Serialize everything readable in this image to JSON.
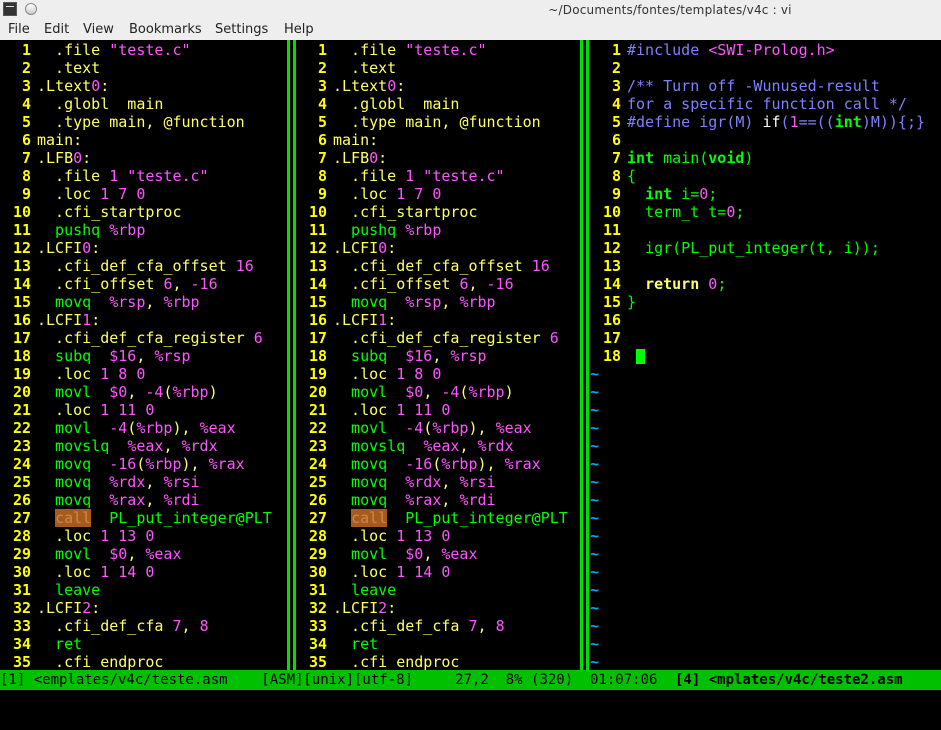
{
  "window": {
    "title": "~/Documents/fontes/templates/v4c : vi"
  },
  "menubar": {
    "items": [
      "File",
      "Edit",
      "View",
      "Bookmarks",
      "Settings",
      "Help"
    ]
  },
  "panes": [
    {
      "lines": [
        [
          {
            "t": "  .file ",
            "c": "dir"
          },
          {
            "t": "\"teste.c\"",
            "c": "str"
          }
        ],
        [
          {
            "t": "  .text",
            "c": "dir"
          }
        ],
        [
          {
            "t": ".Ltext",
            "c": "lab"
          },
          {
            "t": "0",
            "c": "num"
          },
          {
            "t": ":",
            "c": "lab"
          }
        ],
        [
          {
            "t": "  .globl  main",
            "c": "dir"
          }
        ],
        [
          {
            "t": "  .type main, ",
            "c": "dir"
          },
          {
            "t": "@function",
            "c": "dir"
          }
        ],
        [
          {
            "t": "main:",
            "c": "lab"
          }
        ],
        [
          {
            "t": ".LFB",
            "c": "lab"
          },
          {
            "t": "0",
            "c": "num"
          },
          {
            "t": ":",
            "c": "lab"
          }
        ],
        [
          {
            "t": "  .file ",
            "c": "dir"
          },
          {
            "t": "1",
            "c": "num"
          },
          {
            "t": " \"teste.c\"",
            "c": "str"
          }
        ],
        [
          {
            "t": "  .loc ",
            "c": "dir"
          },
          {
            "t": "1 7 0",
            "c": "num"
          }
        ],
        [
          {
            "t": "  .cfi_startproc",
            "c": "dir"
          }
        ],
        [
          {
            "t": "  pushq ",
            "c": "ins"
          },
          {
            "t": "%rbp",
            "c": "reg"
          }
        ],
        [
          {
            "t": ".LCFI",
            "c": "lab"
          },
          {
            "t": "0",
            "c": "num"
          },
          {
            "t": ":",
            "c": "lab"
          }
        ],
        [
          {
            "t": "  .cfi_def_cfa_offset ",
            "c": "dir"
          },
          {
            "t": "16",
            "c": "num"
          }
        ],
        [
          {
            "t": "  .cfi_offset ",
            "c": "dir"
          },
          {
            "t": "6",
            "c": "num"
          },
          {
            "t": ", ",
            "c": "p"
          },
          {
            "t": "-16",
            "c": "num"
          }
        ],
        [
          {
            "t": "  movq  ",
            "c": "ins"
          },
          {
            "t": "%rsp",
            "c": "reg"
          },
          {
            "t": ", ",
            "c": "p"
          },
          {
            "t": "%rbp",
            "c": "reg"
          }
        ],
        [
          {
            "t": ".LCFI",
            "c": "lab"
          },
          {
            "t": "1",
            "c": "num"
          },
          {
            "t": ":",
            "c": "lab"
          }
        ],
        [
          {
            "t": "  .cfi_def_cfa_register ",
            "c": "dir"
          },
          {
            "t": "6",
            "c": "num"
          }
        ],
        [
          {
            "t": "  subq  ",
            "c": "ins"
          },
          {
            "t": "$16",
            "c": "num"
          },
          {
            "t": ", ",
            "c": "p"
          },
          {
            "t": "%rsp",
            "c": "reg"
          }
        ],
        [
          {
            "t": "  .loc ",
            "c": "dir"
          },
          {
            "t": "1 8 0",
            "c": "num"
          }
        ],
        [
          {
            "t": "  movl  ",
            "c": "ins"
          },
          {
            "t": "$0",
            "c": "num"
          },
          {
            "t": ", ",
            "c": "p"
          },
          {
            "t": "-4",
            "c": "num"
          },
          {
            "t": "(",
            "c": "p"
          },
          {
            "t": "%rbp",
            "c": "reg"
          },
          {
            "t": ")",
            "c": "p"
          }
        ],
        [
          {
            "t": "  .loc ",
            "c": "dir"
          },
          {
            "t": "1 11 0",
            "c": "num"
          }
        ],
        [
          {
            "t": "  movl  ",
            "c": "ins"
          },
          {
            "t": "-4",
            "c": "num"
          },
          {
            "t": "(",
            "c": "p"
          },
          {
            "t": "%rbp",
            "c": "reg"
          },
          {
            "t": "), ",
            "c": "p"
          },
          {
            "t": "%eax",
            "c": "reg"
          }
        ],
        [
          {
            "t": "  movslq  ",
            "c": "ins"
          },
          {
            "t": "%eax",
            "c": "reg"
          },
          {
            "t": ", ",
            "c": "p"
          },
          {
            "t": "%rdx",
            "c": "reg"
          }
        ],
        [
          {
            "t": "  movq  ",
            "c": "ins"
          },
          {
            "t": "-16",
            "c": "num"
          },
          {
            "t": "(",
            "c": "p"
          },
          {
            "t": "%rbp",
            "c": "reg"
          },
          {
            "t": "), ",
            "c": "p"
          },
          {
            "t": "%rax",
            "c": "reg"
          }
        ],
        [
          {
            "t": "  movq  ",
            "c": "ins"
          },
          {
            "t": "%rdx",
            "c": "reg"
          },
          {
            "t": ", ",
            "c": "p"
          },
          {
            "t": "%rsi",
            "c": "reg"
          }
        ],
        [
          {
            "t": "  movq  ",
            "c": "ins"
          },
          {
            "t": "%rax",
            "c": "reg"
          },
          {
            "t": ", ",
            "c": "p"
          },
          {
            "t": "%rdi",
            "c": "reg"
          }
        ],
        [
          {
            "t": "  ",
            "c": "ins"
          },
          {
            "t": "call",
            "c": "hl"
          },
          {
            "t": "  PL_put_integer@PLT",
            "c": "ins"
          }
        ],
        [
          {
            "t": "  .loc ",
            "c": "dir"
          },
          {
            "t": "1 13 0",
            "c": "num"
          }
        ],
        [
          {
            "t": "  movl  ",
            "c": "ins"
          },
          {
            "t": "$0",
            "c": "num"
          },
          {
            "t": ", ",
            "c": "p"
          },
          {
            "t": "%eax",
            "c": "reg"
          }
        ],
        [
          {
            "t": "  .loc ",
            "c": "dir"
          },
          {
            "t": "1 14 0",
            "c": "num"
          }
        ],
        [
          {
            "t": "  leave",
            "c": "ins"
          }
        ],
        [
          {
            "t": ".LCFI",
            "c": "lab"
          },
          {
            "t": "2",
            "c": "num"
          },
          {
            "t": ":",
            "c": "lab"
          }
        ],
        [
          {
            "t": "  .cfi_def_cfa ",
            "c": "dir"
          },
          {
            "t": "7",
            "c": "num"
          },
          {
            "t": ", ",
            "c": "p"
          },
          {
            "t": "8",
            "c": "num"
          }
        ],
        [
          {
            "t": "  ret",
            "c": "ins"
          }
        ],
        [
          {
            "t": "  .cfi_endproc",
            "c": "dir"
          }
        ]
      ],
      "tildes": 0
    },
    {
      "lines": [
        [
          {
            "t": "  .file ",
            "c": "dir"
          },
          {
            "t": "\"teste.c\"",
            "c": "str"
          }
        ],
        [
          {
            "t": "  .text",
            "c": "dir"
          }
        ],
        [
          {
            "t": ".Ltext",
            "c": "lab"
          },
          {
            "t": "0",
            "c": "num"
          },
          {
            "t": ":",
            "c": "lab"
          }
        ],
        [
          {
            "t": "  .globl  main",
            "c": "dir"
          }
        ],
        [
          {
            "t": "  .type main, ",
            "c": "dir"
          },
          {
            "t": "@function",
            "c": "dir"
          }
        ],
        [
          {
            "t": "main:",
            "c": "lab"
          }
        ],
        [
          {
            "t": ".LFB",
            "c": "lab"
          },
          {
            "t": "0",
            "c": "num"
          },
          {
            "t": ":",
            "c": "lab"
          }
        ],
        [
          {
            "t": "  .file ",
            "c": "dir"
          },
          {
            "t": "1",
            "c": "num"
          },
          {
            "t": " \"teste.c\"",
            "c": "str"
          }
        ],
        [
          {
            "t": "  .loc ",
            "c": "dir"
          },
          {
            "t": "1 7 0",
            "c": "num"
          }
        ],
        [
          {
            "t": "  .cfi_startproc",
            "c": "dir"
          }
        ],
        [
          {
            "t": "  pushq ",
            "c": "ins"
          },
          {
            "t": "%rbp",
            "c": "reg"
          }
        ],
        [
          {
            "t": ".LCFI",
            "c": "lab"
          },
          {
            "t": "0",
            "c": "num"
          },
          {
            "t": ":",
            "c": "lab"
          }
        ],
        [
          {
            "t": "  .cfi_def_cfa_offset ",
            "c": "dir"
          },
          {
            "t": "16",
            "c": "num"
          }
        ],
        [
          {
            "t": "  .cfi_offset ",
            "c": "dir"
          },
          {
            "t": "6",
            "c": "num"
          },
          {
            "t": ", ",
            "c": "p"
          },
          {
            "t": "-16",
            "c": "num"
          }
        ],
        [
          {
            "t": "  movq  ",
            "c": "ins"
          },
          {
            "t": "%rsp",
            "c": "reg"
          },
          {
            "t": ", ",
            "c": "p"
          },
          {
            "t": "%rbp",
            "c": "reg"
          }
        ],
        [
          {
            "t": ".LCFI",
            "c": "lab"
          },
          {
            "t": "1",
            "c": "num"
          },
          {
            "t": ":",
            "c": "lab"
          }
        ],
        [
          {
            "t": "  .cfi_def_cfa_register ",
            "c": "dir"
          },
          {
            "t": "6",
            "c": "num"
          }
        ],
        [
          {
            "t": "  subq  ",
            "c": "ins"
          },
          {
            "t": "$16",
            "c": "num"
          },
          {
            "t": ", ",
            "c": "p"
          },
          {
            "t": "%rsp",
            "c": "reg"
          }
        ],
        [
          {
            "t": "  .loc ",
            "c": "dir"
          },
          {
            "t": "1 8 0",
            "c": "num"
          }
        ],
        [
          {
            "t": "  movl  ",
            "c": "ins"
          },
          {
            "t": "$0",
            "c": "num"
          },
          {
            "t": ", ",
            "c": "p"
          },
          {
            "t": "-4",
            "c": "num"
          },
          {
            "t": "(",
            "c": "p"
          },
          {
            "t": "%rbp",
            "c": "reg"
          },
          {
            "t": ")",
            "c": "p"
          }
        ],
        [
          {
            "t": "  .loc ",
            "c": "dir"
          },
          {
            "t": "1 11 0",
            "c": "num"
          }
        ],
        [
          {
            "t": "  movl  ",
            "c": "ins"
          },
          {
            "t": "-4",
            "c": "num"
          },
          {
            "t": "(",
            "c": "p"
          },
          {
            "t": "%rbp",
            "c": "reg"
          },
          {
            "t": "), ",
            "c": "p"
          },
          {
            "t": "%eax",
            "c": "reg"
          }
        ],
        [
          {
            "t": "  movslq  ",
            "c": "ins"
          },
          {
            "t": "%eax",
            "c": "reg"
          },
          {
            "t": ", ",
            "c": "p"
          },
          {
            "t": "%rdx",
            "c": "reg"
          }
        ],
        [
          {
            "t": "  movq  ",
            "c": "ins"
          },
          {
            "t": "-16",
            "c": "num"
          },
          {
            "t": "(",
            "c": "p"
          },
          {
            "t": "%rbp",
            "c": "reg"
          },
          {
            "t": "), ",
            "c": "p"
          },
          {
            "t": "%rax",
            "c": "reg"
          }
        ],
        [
          {
            "t": "  movq  ",
            "c": "ins"
          },
          {
            "t": "%rdx",
            "c": "reg"
          },
          {
            "t": ", ",
            "c": "p"
          },
          {
            "t": "%rsi",
            "c": "reg"
          }
        ],
        [
          {
            "t": "  movq  ",
            "c": "ins"
          },
          {
            "t": "%rax",
            "c": "reg"
          },
          {
            "t": ", ",
            "c": "p"
          },
          {
            "t": "%rdi",
            "c": "reg"
          }
        ],
        [
          {
            "t": "  ",
            "c": "ins"
          },
          {
            "t": "call",
            "c": "hl"
          },
          {
            "t": "  PL_put_integer@PLT",
            "c": "ins"
          }
        ],
        [
          {
            "t": "  .loc ",
            "c": "dir"
          },
          {
            "t": "1 13 0",
            "c": "num"
          }
        ],
        [
          {
            "t": "  movl  ",
            "c": "ins"
          },
          {
            "t": "$0",
            "c": "num"
          },
          {
            "t": ", ",
            "c": "p"
          },
          {
            "t": "%eax",
            "c": "reg"
          }
        ],
        [
          {
            "t": "  .loc ",
            "c": "dir"
          },
          {
            "t": "1 14 0",
            "c": "num"
          }
        ],
        [
          {
            "t": "  leave",
            "c": "ins"
          }
        ],
        [
          {
            "t": ".LCFI",
            "c": "lab"
          },
          {
            "t": "2",
            "c": "num"
          },
          {
            "t": ":",
            "c": "lab"
          }
        ],
        [
          {
            "t": "  .cfi_def_cfa ",
            "c": "dir"
          },
          {
            "t": "7",
            "c": "num"
          },
          {
            "t": ", ",
            "c": "p"
          },
          {
            "t": "8",
            "c": "num"
          }
        ],
        [
          {
            "t": "  ret",
            "c": "ins"
          }
        ],
        [
          {
            "t": "  .cfi_endproc",
            "c": "dir"
          }
        ]
      ],
      "tildes": 0
    },
    {
      "lines": [
        [
          {
            "t": "#include ",
            "c": "pp"
          },
          {
            "t": "<SWI-Prolog.h>",
            "c": "inc"
          }
        ],
        [],
        [
          {
            "t": "/** Turn off -Wunused-result",
            "c": "com"
          }
        ],
        [
          {
            "t": "for a specific function call */",
            "c": "com"
          }
        ],
        [
          {
            "t": "#define ",
            "c": "pp"
          },
          {
            "t": "igr(M)",
            "c": "pp"
          },
          {
            "t": " ",
            "c": "n"
          },
          {
            "t": "if",
            "c": "wn"
          },
          {
            "t": "(",
            "c": "pp"
          },
          {
            "t": "1",
            "c": "inc"
          },
          {
            "t": "==((",
            "c": "pp"
          },
          {
            "t": "int",
            "c": "ty"
          },
          {
            "t": ")M)){;}",
            "c": "pp"
          }
        ],
        [],
        [
          {
            "t": "int",
            "c": "ty"
          },
          {
            "t": " main(",
            "c": "n"
          },
          {
            "t": "void",
            "c": "ty"
          },
          {
            "t": ")",
            "c": "n"
          }
        ],
        [
          {
            "t": "{",
            "c": "n"
          }
        ],
        [
          {
            "t": "  ",
            "c": "n"
          },
          {
            "t": "int",
            "c": "ty"
          },
          {
            "t": " i=",
            "c": "n"
          },
          {
            "t": "0",
            "c": "inc"
          },
          {
            "t": ";",
            "c": "n"
          }
        ],
        [
          {
            "t": "  term_t t=",
            "c": "n"
          },
          {
            "t": "0",
            "c": "inc"
          },
          {
            "t": ";",
            "c": "n"
          }
        ],
        [],
        [
          {
            "t": "  igr(PL_put_integer(t, i));",
            "c": "n"
          }
        ],
        [],
        [
          {
            "t": "  ",
            "c": "n"
          },
          {
            "t": "return",
            "c": "kw"
          },
          {
            "t": " ",
            "c": "n"
          },
          {
            "t": "0",
            "c": "inc"
          },
          {
            "t": ";",
            "c": "n"
          }
        ],
        [
          {
            "t": "}",
            "c": "n"
          }
        ],
        [],
        [],
        [
          {
            "t": " ",
            "c": "n"
          },
          {
            "t": "CURSOR",
            "c": "cursor"
          }
        ]
      ],
      "tildes": 17
    }
  ],
  "statusbar": {
    "left": "[1] <emplates/v4c/teste.asm    [ASM][unix][utf-8]     27,2  8% (320)  01:07:06 ",
    "right": "[4] <mplates/v4c/teste2.asm"
  },
  "colors": {
    "line_number": "#ffff00",
    "tilde": "#00aaff",
    "divider": "#00e000",
    "statusbar": "#00c000"
  }
}
